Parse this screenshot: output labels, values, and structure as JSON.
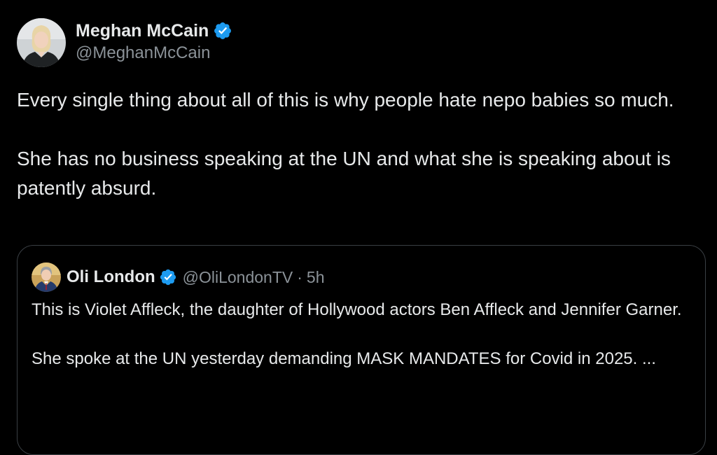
{
  "tweet": {
    "author": {
      "display_name": "Meghan McCain",
      "handle": "@MeghanMcCain",
      "verified_icon": "verified-badge-icon",
      "avatar_icon": "avatar"
    },
    "paragraphs": [
      "Every single thing about all of this is why people hate nepo babies so much.",
      "She has no business speaking at the UN and what she is speaking about is patently absurd."
    ]
  },
  "quote": {
    "author": {
      "display_name": "Oli London",
      "handle": "@OliLondonTV",
      "separator": "·",
      "time": "5h",
      "verified_icon": "verified-badge-icon"
    },
    "paragraphs": [
      "This is Violet Affleck, the daughter of Hollywood actors Ben Affleck and Jennifer Garner.",
      "She spoke at the UN yesterday demanding MASK MANDATES for Covid in 2025. ..."
    ]
  },
  "colors": {
    "background": "#000000",
    "text": "#e7e9ea",
    "secondary_text": "#8b9298",
    "verified_blue": "#1d9bf0",
    "border": "#3a3f44"
  }
}
